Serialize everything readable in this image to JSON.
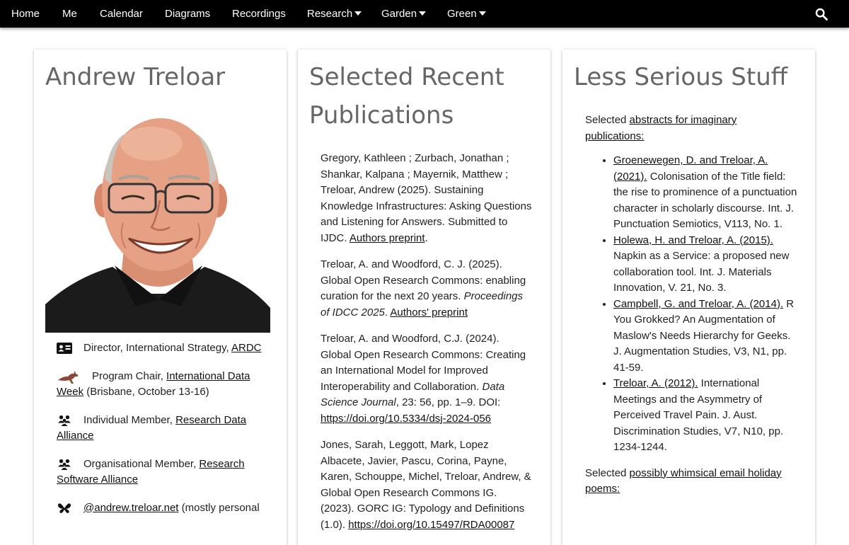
{
  "nav": {
    "items": [
      {
        "label": "Home",
        "dropdown": false
      },
      {
        "label": "Me",
        "dropdown": false
      },
      {
        "label": "Calendar",
        "dropdown": false
      },
      {
        "label": "Diagrams",
        "dropdown": false
      },
      {
        "label": "Recordings",
        "dropdown": false
      },
      {
        "label": "Research",
        "dropdown": true
      },
      {
        "label": "Garden",
        "dropdown": true
      },
      {
        "label": "Green",
        "dropdown": true
      }
    ],
    "search_icon": "search-icon"
  },
  "profile": {
    "title": "Andrew Treloar",
    "roles": [
      {
        "icon": "id-card-icon",
        "text": "Director, International Strategy, ",
        "link": "ARDC",
        "after": ""
      },
      {
        "icon": "kangaroo-icon",
        "text": "Program Chair, ",
        "link": "International Data Week",
        "after": " (Brisbane, October 13-16)"
      },
      {
        "icon": "people-group-icon",
        "text": "Individual Member, ",
        "link": "Research Data Alliance",
        "after": ""
      },
      {
        "icon": "people-group-icon",
        "text": "Organisational Member, ",
        "link": "Research Software Alliance",
        "after": ""
      },
      {
        "icon": "butterfly-icon",
        "text": "",
        "link": "@andrew.treloar.net",
        "after": " (mostly personal"
      }
    ]
  },
  "publications": {
    "title": "Selected Recent Publications",
    "items": [
      {
        "text": "Gregory, Kathleen ; Zurbach, Jonathan ; Shankar, Kalpana ; Mayernik, Matthew ; Treloar, Andrew (2025). Sustaining Knowledge Infrastructures: Asking Questions and Listening for Answers. Submitted to IJDC. ",
        "italic": "",
        "mid": "",
        "link": "Authors preprint",
        "after": "."
      },
      {
        "text": "Treloar, A. and Woodford, C. J. (2025). Global Open Research Commons: enabling curation for the next 20 years. ",
        "italic": "Proceedings of IDCC 2025",
        "mid": ". ",
        "link": "Authors' preprint",
        "after": ""
      },
      {
        "text": "Treloar, A. and Woodford, C.J. (2024). Global Open Research Commons: Creating an International Model for Improved Interoperability and Collaboration. ",
        "italic": "Data Science Journal",
        "mid": ", 23: 56, pp. 1–9. DOI: ",
        "link": "https://doi.org/10.5334/dsj-2024-056",
        "after": ""
      },
      {
        "text": "Jones, Sarah, Leggott, Mark, Lopez Albacete, Javier, Pascu, Corina, Payne, Karen, Schouppe, Michel, Treloar, Andrew, & Global Open Research Commons IG. (2023). GORC IG: Typology and Definitions (1.0). ",
        "italic": "",
        "mid": "",
        "link": "https://doi.org/10.15497/RDA00087",
        "after": ""
      }
    ]
  },
  "less_serious": {
    "title": "Less Serious Stuff",
    "intro_text": "Selected ",
    "intro_link": "abstracts for imaginary publications:",
    "items": [
      {
        "link": "Groenewegen, D. and Treloar, A. (2021).",
        "text": " Colonisation of the Title field: the rise to prominence of a punctuation character in scholarly discourse. Int. J. Punctuation Semiotics, V113, No. 1."
      },
      {
        "link": "Holewa, H. and Treloar, A. (2015).",
        "text": " Napkin as a Service: a proposed new collaboration tool. Int. J. Materials Innovation, V. 21, No. 3."
      },
      {
        "link": "Campbell, G. and Treloar, A. (2014).",
        "text": " R You Grokked? An Augmentation of Maslow's Needs Hierarchy for Geeks. J. Augmentation Studies, V3, N1, pp. 41-59."
      },
      {
        "link": "Treloar, A. (2012).",
        "text": " International Meetings and the Asymmetry of Perceived Travel Pain. J. Aust. Discrimination Studies, V7, N10, pp. 1234-1244."
      }
    ],
    "outro_text": "Selected ",
    "outro_link": "possibly whimsical email holiday poems:"
  }
}
